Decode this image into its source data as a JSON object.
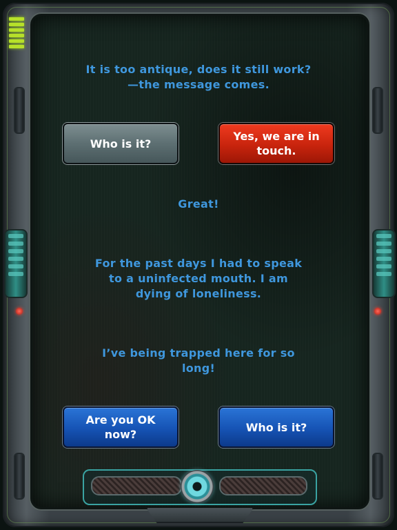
{
  "dialog": {
    "question": "It is too antique, does it still work?—the message comes.",
    "reply_1": "Great!",
    "reply_2": "For the past days I had to speak to a uninfected mouth. I am dying of loneliness.",
    "reply_3": "I’ve being trapped here for so long!"
  },
  "choices_top": {
    "left_label": "Who is it?",
    "right_label": "Yes, we are in touch."
  },
  "choices_bottom": {
    "left_label": "Are you OK now?",
    "right_label": "Who is it?"
  },
  "icons": {
    "settings": "gear-icon"
  },
  "colors": {
    "dialog_text": "#3f97dd",
    "button_red": "#c8240d",
    "button_blue": "#1653b4",
    "button_grey": "#5d6f72",
    "led_green": "#b6e02a"
  }
}
